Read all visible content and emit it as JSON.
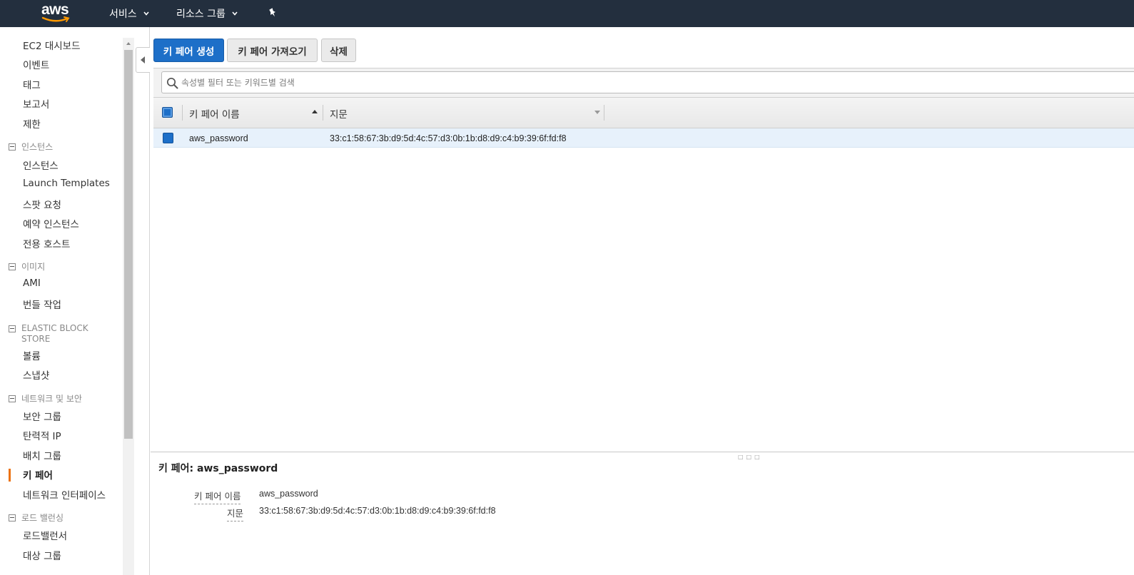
{
  "topnav": {
    "logo": "aws",
    "services": "서비스",
    "resource_groups": "리소스 그룹"
  },
  "sidebar": {
    "items_top": [
      "EC2 대시보드",
      "이벤트",
      "태그",
      "보고서",
      "제한"
    ],
    "sections": [
      {
        "title": "인스턴스",
        "items": [
          "인스턴스",
          "Launch Templates",
          "스팟 요청",
          "예약 인스턴스",
          "전용 호스트"
        ]
      },
      {
        "title": "이미지",
        "items": [
          "AMI",
          "번들 작업"
        ]
      },
      {
        "title": "ELASTIC BLOCK STORE",
        "items": [
          "볼륨",
          "스냅샷"
        ]
      },
      {
        "title": "네트워크 및 보안",
        "items": [
          "보안 그룹",
          "탄력적 IP",
          "배치 그룹",
          "키 페어",
          "네트워크 인터페이스"
        ]
      },
      {
        "title": "로드 밸런싱",
        "items": [
          "로드밸런서",
          "대상 그룹"
        ]
      }
    ],
    "active": "키 페어"
  },
  "toolbar": {
    "create": "키 페어 생성",
    "import": "키 페어 가져오기",
    "delete": "삭제"
  },
  "search": {
    "placeholder": "속성별 필터 또는 키워드별 검색"
  },
  "table": {
    "columns": [
      "키 페어 이름",
      "지문"
    ],
    "rows": [
      {
        "name": "aws_password",
        "fingerprint": "33:c1:58:67:3b:d9:5d:4c:57:d3:0b:1b:d8:d9:c4:b9:39:6f:fd:f8",
        "selected": true
      }
    ]
  },
  "detail": {
    "title": "키 페어: aws_password",
    "fields": [
      {
        "label": "키 페어 이름",
        "value": "aws_password"
      },
      {
        "label": "지문",
        "value": "33:c1:58:67:3b:d9:5d:4c:57:d3:0b:1b:d8:d9:c4:b9:39:6f:fd:f8"
      }
    ]
  },
  "colors": {
    "topbar": "#232f3e",
    "primary": "#1d6fc8",
    "active_marker": "#ec7211",
    "selected_row": "#e7f1fb"
  }
}
